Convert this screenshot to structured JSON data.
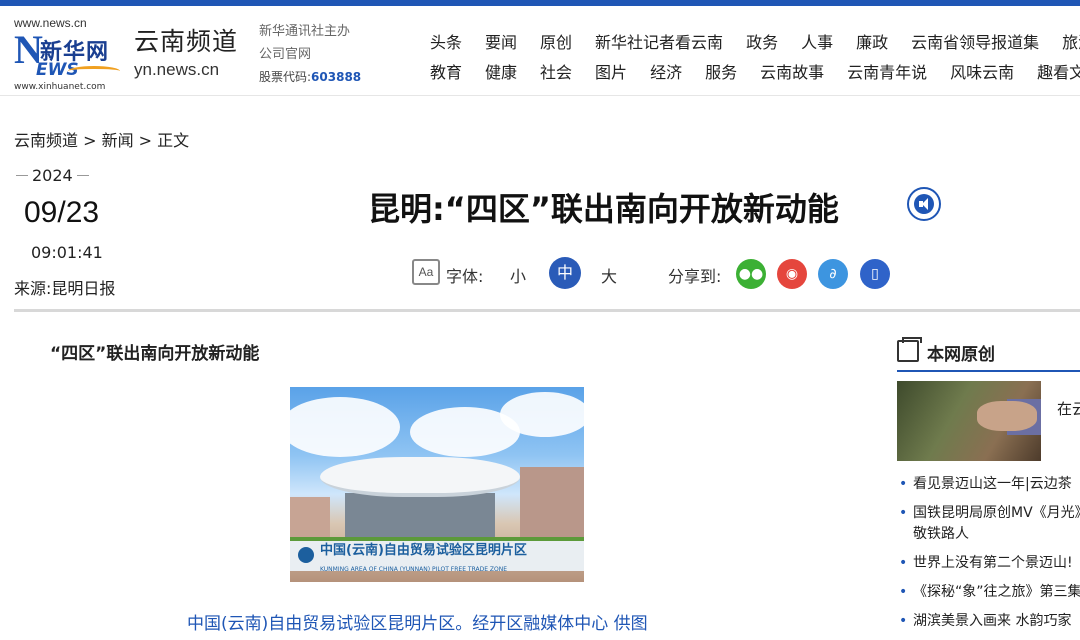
{
  "header": {
    "site_url": "www.news.cn",
    "logo_cn": "新华网",
    "logo_en_n": "N",
    "logo_en_rest": "EWS",
    "logo_url2": "www.xinhuanet.com",
    "channel_cn": "云南频道",
    "channel_en": "yn.news.cn",
    "sponsor_line1": "新华通讯社主办",
    "sponsor_line2": "公司官网",
    "stock_label": "股票代码:",
    "stock_code": "603888"
  },
  "nav": {
    "row1": [
      "头条",
      "要闻",
      "原创",
      "新华社记者看云南",
      "政务",
      "人事",
      "廉政",
      "云南省领导报道集",
      "旅游"
    ],
    "row2": [
      "教育",
      "健康",
      "社会",
      "图片",
      "经济",
      "服务",
      "云南故事",
      "云南青年说",
      "风味云南",
      "趣看文"
    ]
  },
  "breadcrumb": "云南频道 > 新闻 > 正文",
  "article": {
    "year": "2024",
    "month_day": "09/23",
    "time": "09:01:41",
    "source": "来源:昆明日报",
    "title": "昆明:“四区”联出南向开放新动能",
    "subheadline": "“四区”联出南向开放新动能",
    "photo_sign": "中国(云南)自由贸易试验区昆明片区",
    "photo_sign_en": "KUNMING AREA OF CHINA (YUNNAN) PILOT FREE TRADE ZONE",
    "caption": "中国(云南)自由贸易试验区昆明片区。经开区融媒体中心 供图"
  },
  "tools": {
    "font_icon": "Aa",
    "font_label": "字体:",
    "font_small": "小",
    "font_medium": "中",
    "font_large": "大",
    "share_label": "分享到:"
  },
  "share": [
    {
      "name": "wechat-icon",
      "color": "#3cb034"
    },
    {
      "name": "weibo-icon",
      "color": "#e5463d"
    },
    {
      "name": "link-icon",
      "color": "#3d95e0"
    },
    {
      "name": "mobile-icon",
      "color": "#2f63c9"
    }
  ],
  "sidebar": {
    "title": "本网原创",
    "feature_title": "在云 品尝",
    "items": [
      "看见景迈山这一年|云边茶",
      "国铁昆明局原创MV《月光》",
      "敬铁路人",
      "世界上没有第二个景迈山!",
      "《探秘“象”往之旅》第三集",
      "湖滨美景入画来 水韵巧家"
    ]
  }
}
